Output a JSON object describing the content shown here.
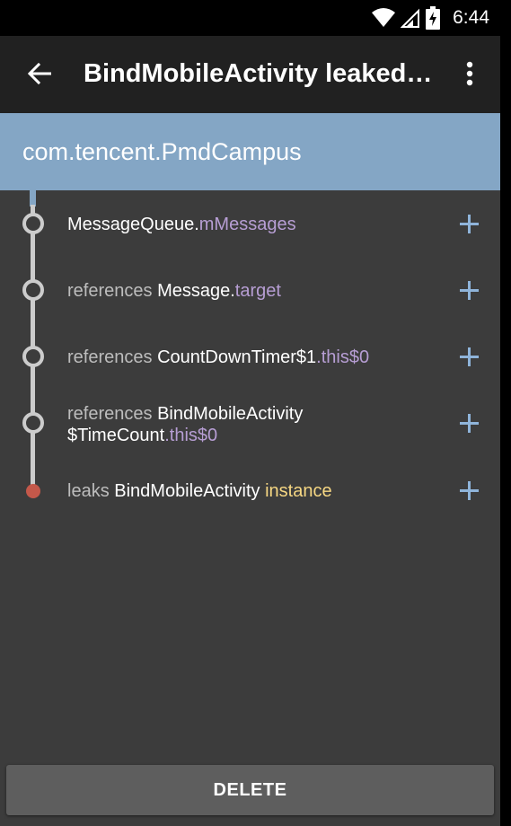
{
  "status_bar": {
    "time": "6:44",
    "icons": [
      "wifi-icon",
      "cellular-signal-icon",
      "battery-charging-icon"
    ]
  },
  "toolbar": {
    "back_icon": "arrow-left-icon",
    "title": "BindMobileActivity leaked by com.tencent.PmdCampus",
    "overflow_icon": "more-vert-icon"
  },
  "header": {
    "package_name": "com.tencent.PmdCampus"
  },
  "trace": [
    {
      "prefix": "",
      "class_name": "MessageQueue",
      "separator": ".",
      "field": "mMessages",
      "expand_icon": "plus-icon"
    },
    {
      "prefix": "references ",
      "class_name": "Message",
      "separator": ".",
      "field": "target",
      "expand_icon": "plus-icon"
    },
    {
      "prefix": "references ",
      "class_name": "CountDownTimer$1",
      "separator": "",
      "field": ".this$0",
      "expand_icon": "plus-icon"
    },
    {
      "prefix": "references ",
      "class_name": "BindMobileActivity $TimeCount",
      "separator": "",
      "field": ".this$0",
      "expand_icon": "plus-icon"
    },
    {
      "prefix": "leaks ",
      "class_name": "BindMobileActivity ",
      "separator": "",
      "field": "instance",
      "expand_icon": "plus-icon"
    }
  ],
  "colors": {
    "toolbar": "#212121",
    "header": "#84a6c5",
    "background": "#3c3c3c",
    "field": "#b79ed4",
    "instance": "#f6d783",
    "leak_node": "#c4584a",
    "plus": "#8fb4da"
  },
  "actions": {
    "delete_label": "DELETE"
  }
}
